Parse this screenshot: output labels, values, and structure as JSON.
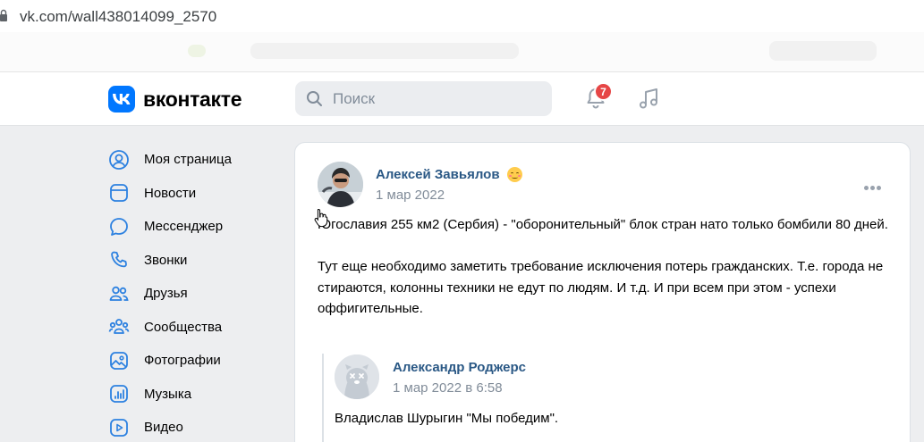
{
  "browser": {
    "url": "vk.com/wall438014099_2570"
  },
  "header": {
    "logo_text": "вконтакте",
    "search_placeholder": "Поиск",
    "notifications_count": "7",
    "accent_color": "#0077ff"
  },
  "sidebar": {
    "items": [
      {
        "label": "Моя страница",
        "icon": "user-circle-icon"
      },
      {
        "label": "Новости",
        "icon": "newsfeed-icon"
      },
      {
        "label": "Мессенджер",
        "icon": "message-bubble-icon"
      },
      {
        "label": "Звонки",
        "icon": "phone-icon"
      },
      {
        "label": "Друзья",
        "icon": "friends-icon"
      },
      {
        "label": "Сообщества",
        "icon": "communities-icon"
      },
      {
        "label": "Фотографии",
        "icon": "photo-icon"
      },
      {
        "label": "Музыка",
        "icon": "music-icon"
      },
      {
        "label": "Видео",
        "icon": "video-icon"
      }
    ]
  },
  "post": {
    "author": "Алексей Завьялов",
    "date": "1 мар 2022",
    "paragraphs": [
      "Югославия 255 км2 (Сербия) - \"оборонительный\" блок стран нато только бомбили 80 дней.",
      "Тут еще необходимо заметить требование исключения потерь гражданских. Т.е. города не стираются, колонны техники не едут по людям. И т.д. И при всем при этом - успехи оффигительные."
    ],
    "repost": {
      "author": "Александр Роджерс",
      "date": "1 мар 2022 в 6:58",
      "text": "Владислав Шурыгин \"Мы победим\"."
    }
  }
}
